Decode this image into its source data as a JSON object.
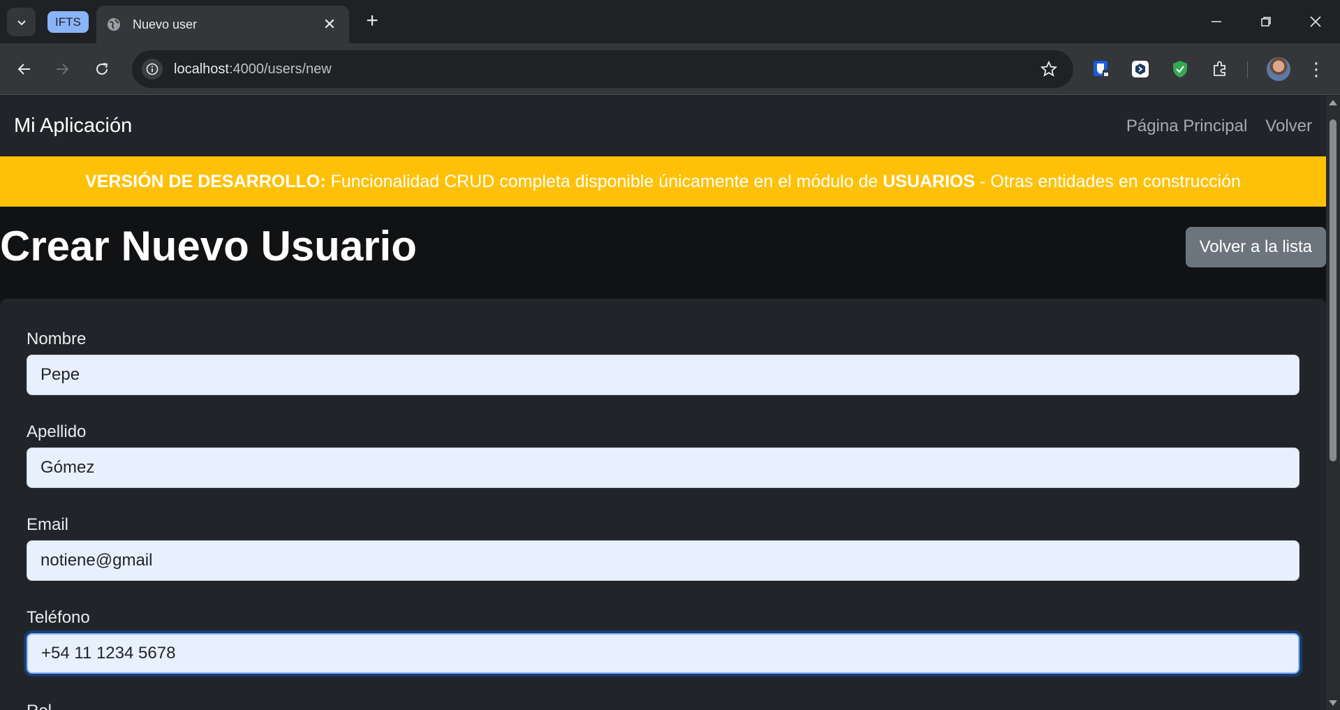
{
  "browser": {
    "tab_group_label": "IFTS",
    "tab_title": "Nuevo user",
    "url_host": "localhost",
    "url_path": ":4000/users/new"
  },
  "navbar": {
    "brand": "Mi Aplicación",
    "links": [
      "Página Principal",
      "Volver"
    ]
  },
  "banner": {
    "bold_prefix": "VERSIÓN DE DESARROLLO:",
    "text_middle": " Funcionalidad CRUD completa disponible únicamente en el módulo de ",
    "bold_module": "USUARIOS",
    "text_suffix": " - Otras entidades en construcción"
  },
  "page": {
    "title": "Crear Nuevo Usuario",
    "back_button": "Volver a la lista"
  },
  "form": {
    "fields": [
      {
        "label": "Nombre",
        "value": "Pepe"
      },
      {
        "label": "Apellido",
        "value": "Gómez"
      },
      {
        "label": "Email",
        "value": "notiene@gmail"
      },
      {
        "label": "Teléfono",
        "value": "+54 11 1234 5678"
      }
    ],
    "next_label_partial": "Rol"
  },
  "colors": {
    "banner": "#ffc107",
    "navbar": "#212529",
    "input_bg": "#e8f0fe",
    "secondary_button": "#6c757d",
    "focus_ring": "#86b7fe"
  }
}
